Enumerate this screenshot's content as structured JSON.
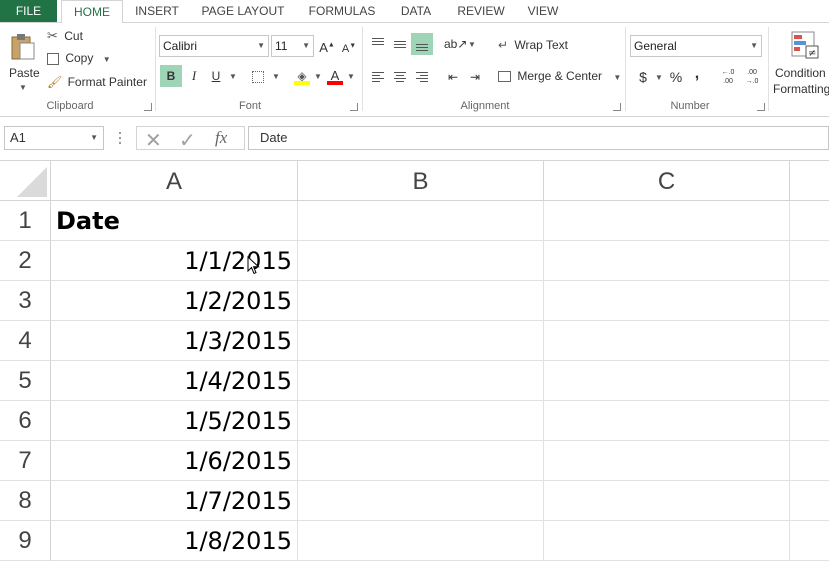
{
  "tabs": {
    "file": "FILE",
    "home": "HOME",
    "insert": "INSERT",
    "page_layout": "PAGE LAYOUT",
    "formulas": "FORMULAS",
    "data": "DATA",
    "review": "REVIEW",
    "view": "VIEW"
  },
  "clipboard": {
    "paste": "Paste",
    "cut": "Cut",
    "copy": "Copy",
    "format_painter": "Format Painter",
    "group_label": "Clipboard"
  },
  "font": {
    "name": "Calibri",
    "size": "11",
    "bold": "B",
    "italic": "I",
    "underline": "U",
    "group_label": "Font",
    "highlight_color": "#ffff00",
    "font_color": "#ff0000"
  },
  "alignment": {
    "wrap_text": "Wrap Text",
    "merge_center": "Merge & Center",
    "group_label": "Alignment"
  },
  "number": {
    "format": "General",
    "currency": "$",
    "percent": "%",
    "comma": ",",
    "increase_decimal": "←.0 .00",
    "decrease_decimal": ".00 →.0",
    "group_label": "Number"
  },
  "styles": {
    "conditional_formatting_line1": "Condition",
    "conditional_formatting_line2": "Formatting"
  },
  "formula_bar": {
    "name_box": "A1",
    "fx": "fx",
    "content": "Date"
  },
  "columns": [
    "A",
    "B",
    "C"
  ],
  "rows": [
    "1",
    "2",
    "3",
    "4",
    "5",
    "6",
    "7",
    "8",
    "9"
  ],
  "cells": {
    "A1": "Date",
    "A2": "1/1/2015",
    "A3": "1/2/2015",
    "A4": "1/3/2015",
    "A5": "1/4/2015",
    "A6": "1/5/2015",
    "A7": "1/6/2015",
    "A8": "1/7/2015",
    "A9": "1/8/2015"
  },
  "colors": {
    "accent": "#217346",
    "bold_active": "#9fd5b7"
  }
}
